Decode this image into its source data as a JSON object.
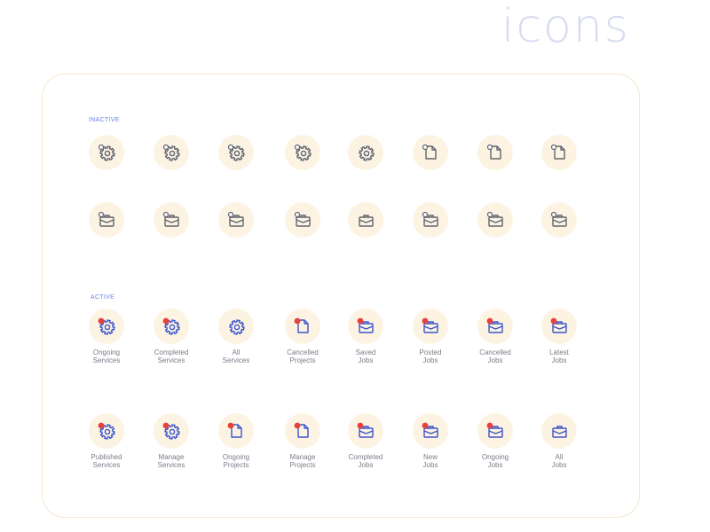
{
  "page_title": "icons",
  "colors": {
    "inactive_stroke": "#5f6470",
    "active_stroke": "#3b55cc",
    "active_dot": "#e8403a",
    "circle_fill": "#fdf3e3",
    "panel_border": "#f8e6cf"
  },
  "sections": [
    {
      "label": "INACTIVE",
      "state": "inactive",
      "rows": [
        {
          "items": [
            {
              "icon": "gear-icon",
              "badge": true,
              "caption": []
            },
            {
              "icon": "gear-icon",
              "badge": true,
              "caption": []
            },
            {
              "icon": "gear-icon",
              "badge": true,
              "caption": []
            },
            {
              "icon": "gear-icon",
              "badge": true,
              "caption": []
            },
            {
              "icon": "gear-icon",
              "badge": false,
              "caption": []
            },
            {
              "icon": "document-icon",
              "badge": true,
              "caption": []
            },
            {
              "icon": "document-icon",
              "badge": true,
              "caption": []
            },
            {
              "icon": "document-icon",
              "badge": true,
              "caption": []
            }
          ]
        },
        {
          "items": [
            {
              "icon": "briefcase-icon",
              "badge": true,
              "caption": []
            },
            {
              "icon": "briefcase-icon",
              "badge": true,
              "caption": []
            },
            {
              "icon": "briefcase-icon",
              "badge": true,
              "caption": []
            },
            {
              "icon": "briefcase-icon",
              "badge": true,
              "caption": []
            },
            {
              "icon": "briefcase-icon",
              "badge": false,
              "caption": []
            },
            {
              "icon": "briefcase-icon",
              "badge": true,
              "caption": []
            },
            {
              "icon": "briefcase-icon",
              "badge": true,
              "caption": []
            },
            {
              "icon": "briefcase-icon",
              "badge": true,
              "caption": []
            }
          ]
        }
      ]
    },
    {
      "label": "ACTIVE",
      "state": "active",
      "rows": [
        {
          "items": [
            {
              "icon": "gear-icon",
              "badge": true,
              "caption": [
                "Ongoing",
                "Services"
              ]
            },
            {
              "icon": "gear-icon",
              "badge": true,
              "caption": [
                "Completed",
                "Services"
              ]
            },
            {
              "icon": "gear-icon",
              "badge": false,
              "caption": [
                "All",
                "Services"
              ]
            },
            {
              "icon": "document-icon",
              "badge": true,
              "caption": [
                "Cancelled",
                "Projects"
              ]
            },
            {
              "icon": "briefcase-icon",
              "badge": true,
              "caption": [
                "Saved",
                "Jobs"
              ]
            },
            {
              "icon": "briefcase-icon",
              "badge": true,
              "caption": [
                "Posted",
                "Jobs"
              ]
            },
            {
              "icon": "briefcase-icon",
              "badge": true,
              "caption": [
                "Cancelled",
                "Jobs"
              ]
            },
            {
              "icon": "briefcase-icon",
              "badge": true,
              "caption": [
                "Latest",
                "Jobs"
              ]
            }
          ]
        },
        {
          "items": [
            {
              "icon": "gear-icon",
              "badge": true,
              "caption": [
                "Published",
                "Services"
              ]
            },
            {
              "icon": "gear-icon",
              "badge": true,
              "caption": [
                "Manage",
                "Services"
              ]
            },
            {
              "icon": "document-icon",
              "badge": true,
              "caption": [
                "Ongoing",
                "Projects"
              ]
            },
            {
              "icon": "document-icon",
              "badge": true,
              "caption": [
                "Manage",
                "Projects"
              ]
            },
            {
              "icon": "briefcase-icon",
              "badge": true,
              "caption": [
                "Completed",
                "Jobs"
              ]
            },
            {
              "icon": "briefcase-icon",
              "badge": true,
              "caption": [
                "New",
                "Jobs"
              ]
            },
            {
              "icon": "briefcase-icon",
              "badge": true,
              "caption": [
                "Ongoing",
                "Jobs"
              ]
            },
            {
              "icon": "briefcase-icon",
              "badge": false,
              "caption": [
                "All",
                "Jobs"
              ]
            }
          ]
        }
      ]
    }
  ]
}
